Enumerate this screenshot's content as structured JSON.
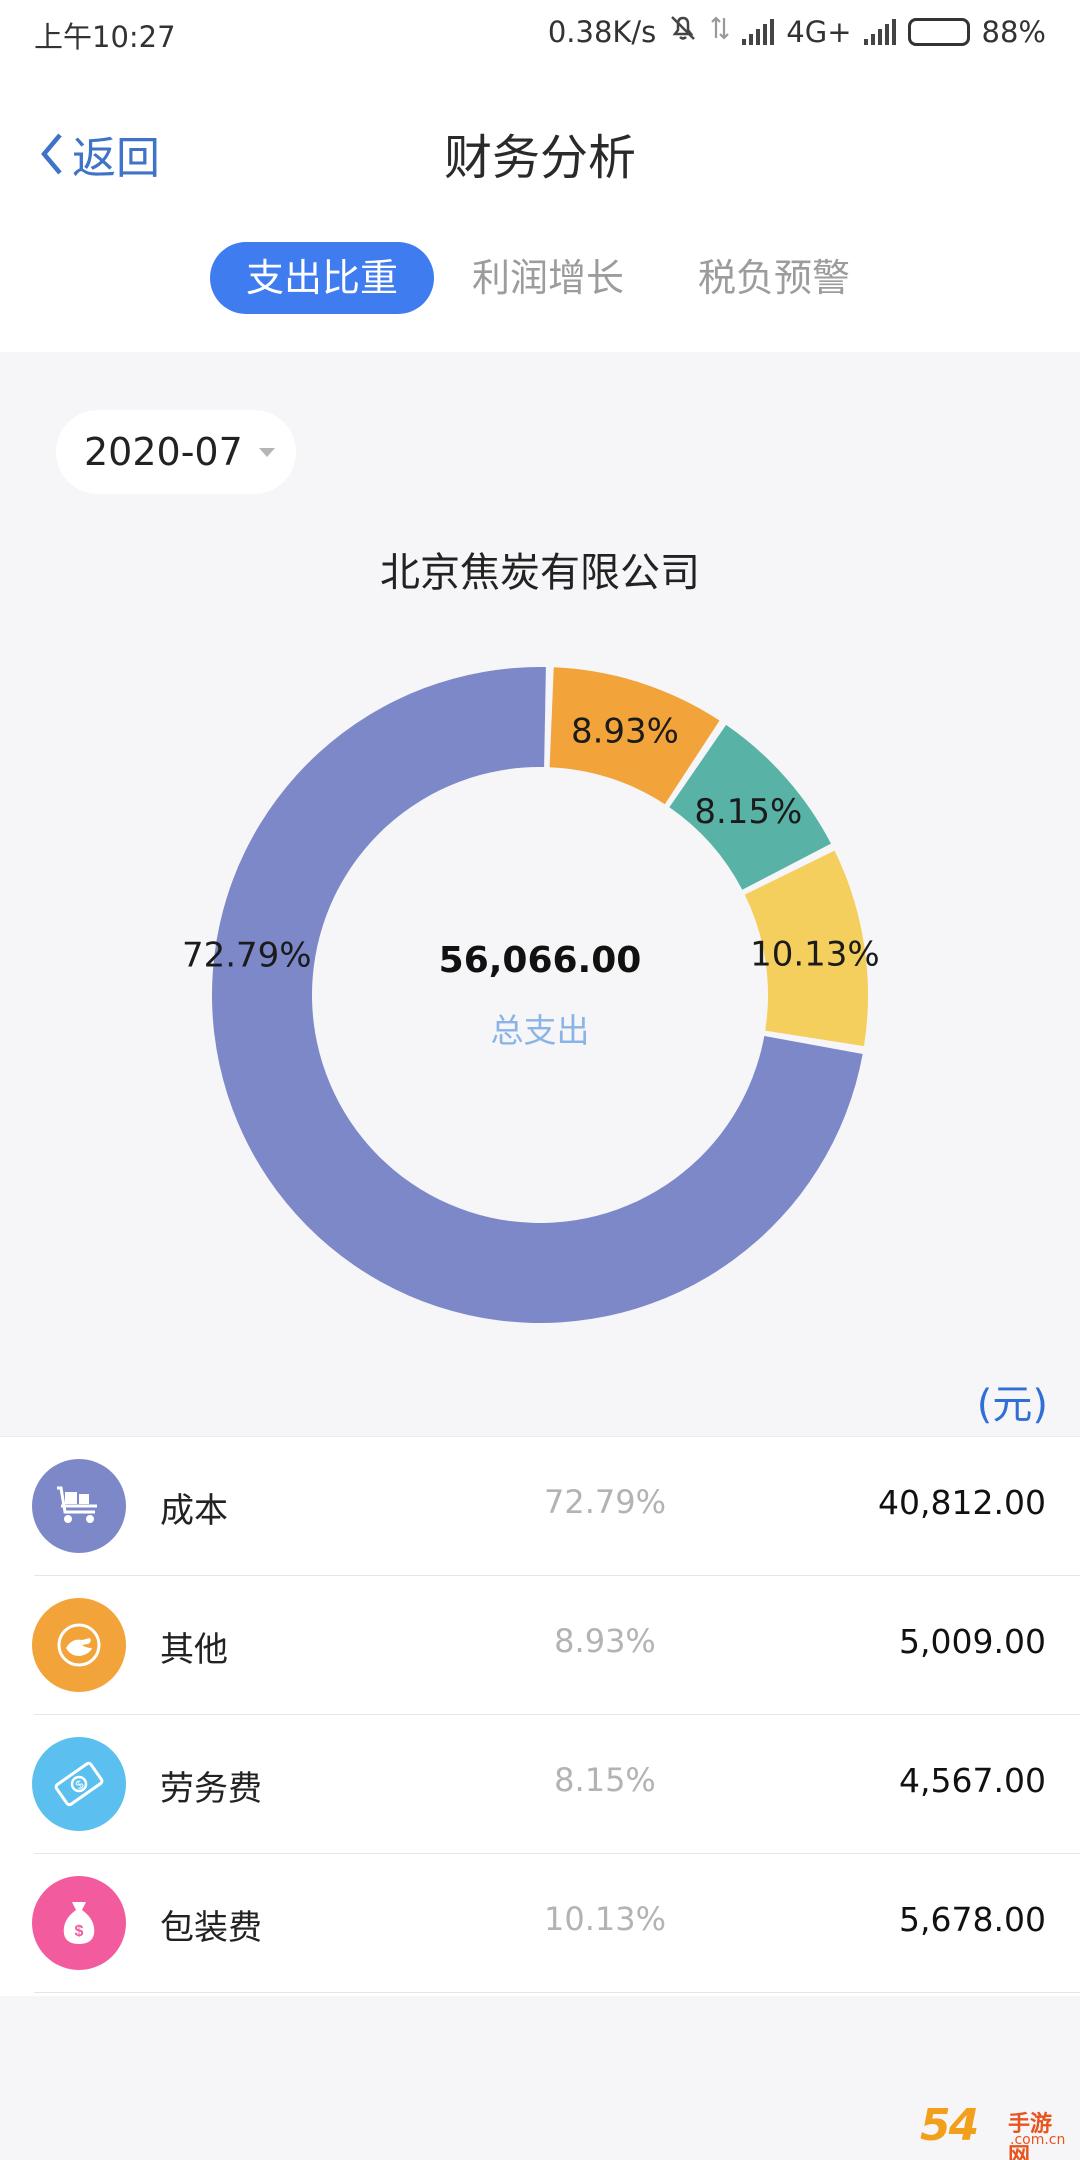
{
  "status": {
    "time": "上午10:27",
    "speed": "0.38K/s",
    "network": "4G+",
    "battery": "88%",
    "battery_level": 0.88
  },
  "nav": {
    "back_label": "返回",
    "title": "财务分析"
  },
  "tabs": [
    {
      "label": "支出比重",
      "active": true
    },
    {
      "label": "利润增长",
      "active": false
    },
    {
      "label": "税负预警",
      "active": false
    }
  ],
  "date": "2020-07",
  "company": "北京焦炭有限公司",
  "center": {
    "total": "56,066.00",
    "label": "总支出"
  },
  "unit": "(元)",
  "chart_data": {
    "type": "pie",
    "style": "donut",
    "total": 56066.0,
    "series": [
      {
        "name": "成本",
        "value": 40812.0,
        "percent": 72.79,
        "label": "72.79%",
        "color": "#7d88c9"
      },
      {
        "name": "其他",
        "value": 5009.0,
        "percent": 8.93,
        "label": "8.93%",
        "color": "#f2a43a"
      },
      {
        "name": "劳务费",
        "value": 4567.0,
        "percent": 8.15,
        "label": "8.15%",
        "color": "#58b3a6"
      },
      {
        "name": "包装费",
        "value": 5678.0,
        "percent": 10.13,
        "label": "10.13%",
        "color": "#f4cf5d"
      }
    ]
  },
  "items": [
    {
      "name": "成本",
      "percent": "72.79%",
      "amount": "40,812.00",
      "icon": "cart-icon",
      "color": "#7d88c9"
    },
    {
      "name": "其他",
      "percent": "8.93%",
      "amount": "5,009.00",
      "icon": "hand-icon",
      "color": "#f2a43a"
    },
    {
      "name": "劳务费",
      "percent": "8.15%",
      "amount": "4,567.00",
      "icon": "money-bill-icon",
      "color": "#5bc0ef"
    },
    {
      "name": "包装费",
      "percent": "10.13%",
      "amount": "5,678.00",
      "icon": "money-bag-icon",
      "color": "#f25c9e"
    }
  ],
  "watermark": {
    "number": "54",
    "text": "手游网",
    "sub": ".com.cn"
  }
}
